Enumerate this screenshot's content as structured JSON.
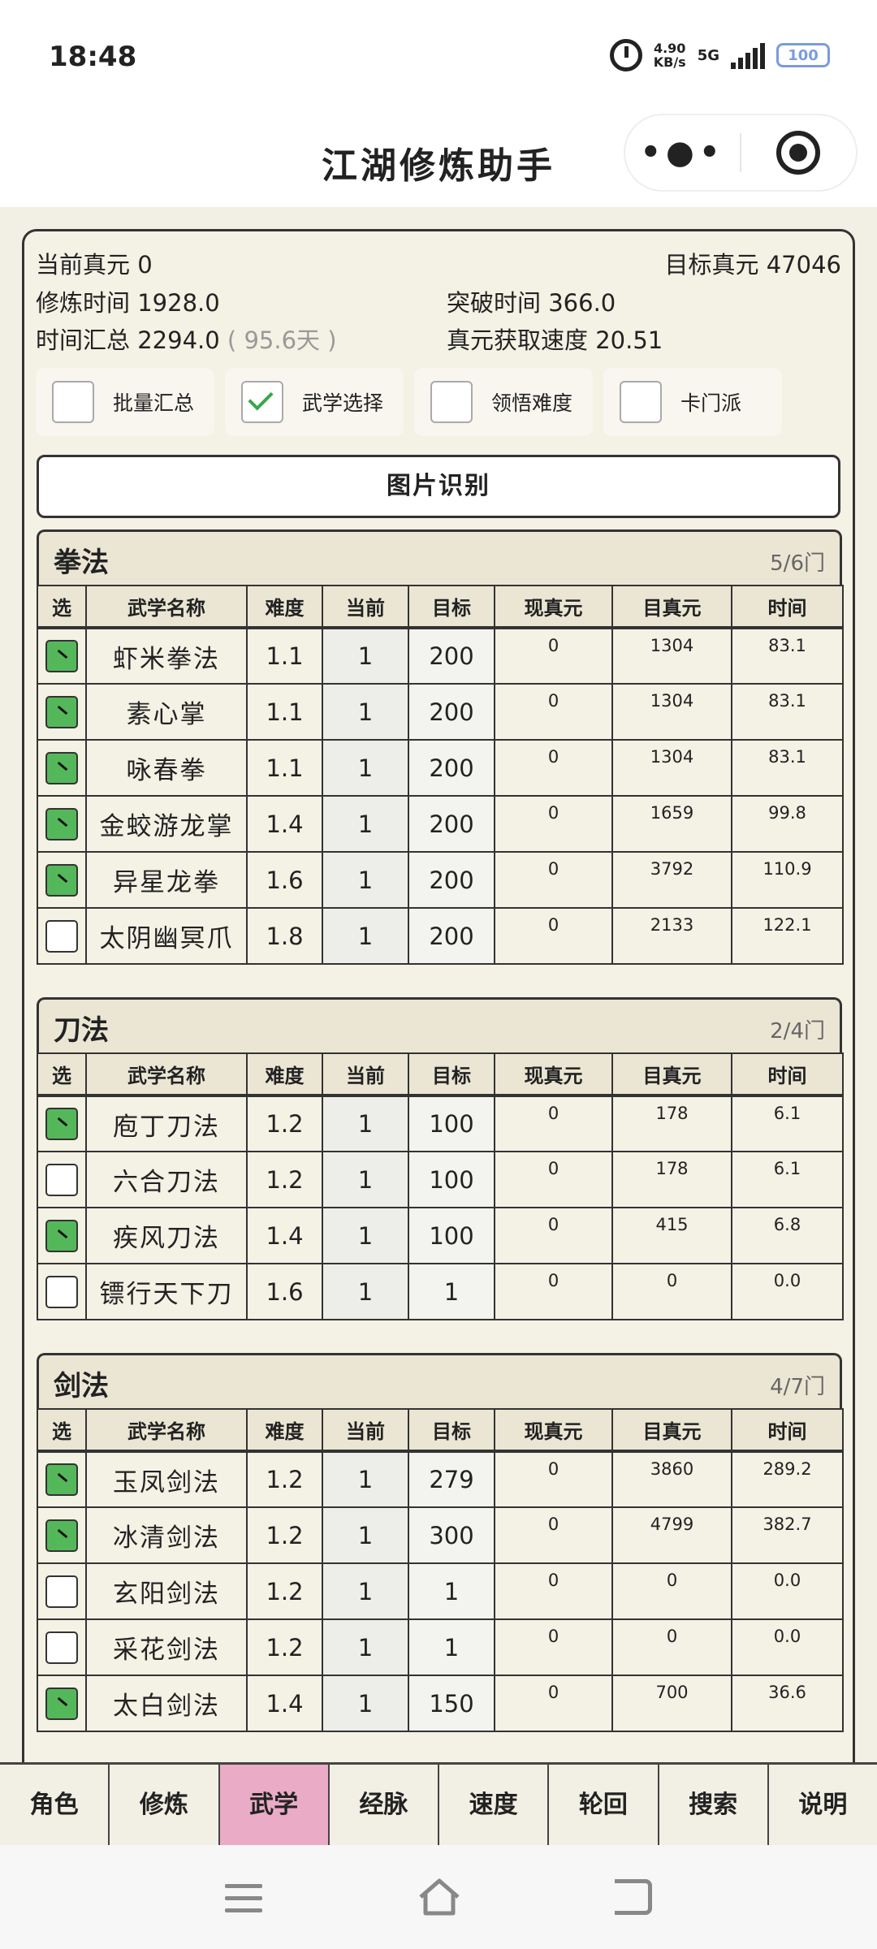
{
  "status": {
    "time": "18:48",
    "net_speed": "4.90",
    "net_unit": "KB/s",
    "signal": "5G",
    "battery": "100"
  },
  "app": {
    "title": "江湖修炼助手",
    "more_icon": "•●•"
  },
  "summary": {
    "current_energy": "当前真元 0",
    "target_energy": "目标真元 47046",
    "train_time": "修炼时间 1928.0",
    "break_time": "突破时间 366.0",
    "total_time": "时间汇总 2294.0",
    "total_days": "( 95.6天 )",
    "gain_speed": "真元获取速度 20.51"
  },
  "options": [
    {
      "label": "批量汇总",
      "checked": false
    },
    {
      "label": "武学选择",
      "checked": true
    },
    {
      "label": "领悟难度",
      "checked": false
    },
    {
      "label": "卡门派",
      "checked": false
    }
  ],
  "ocr_button": "图片识别",
  "columns": [
    "选",
    "武学名称",
    "难度",
    "当前",
    "目标",
    "现真元",
    "目真元",
    "时间"
  ],
  "sections": [
    {
      "title": "拳法",
      "count": "5/6门",
      "rows": [
        {
          "sel": true,
          "name": "虾米拳法",
          "diff": "1.1",
          "cur": "1",
          "tgt": "200",
          "now": "0",
          "need": "1304",
          "time": "83.1"
        },
        {
          "sel": true,
          "name": "素心掌",
          "diff": "1.1",
          "cur": "1",
          "tgt": "200",
          "now": "0",
          "need": "1304",
          "time": "83.1"
        },
        {
          "sel": true,
          "name": "咏春拳",
          "diff": "1.1",
          "cur": "1",
          "tgt": "200",
          "now": "0",
          "need": "1304",
          "time": "83.1"
        },
        {
          "sel": true,
          "name": "金蛟游龙掌",
          "diff": "1.4",
          "cur": "1",
          "tgt": "200",
          "now": "0",
          "need": "1659",
          "time": "99.8"
        },
        {
          "sel": true,
          "name": "异星龙拳",
          "diff": "1.6",
          "cur": "1",
          "tgt": "200",
          "now": "0",
          "need": "3792",
          "time": "110.9"
        },
        {
          "sel": false,
          "name": "太阴幽冥爪",
          "diff": "1.8",
          "cur": "1",
          "tgt": "200",
          "now": "0",
          "need": "2133",
          "time": "122.1"
        }
      ]
    },
    {
      "title": "刀法",
      "count": "2/4门",
      "rows": [
        {
          "sel": true,
          "name": "庖丁刀法",
          "diff": "1.2",
          "cur": "1",
          "tgt": "100",
          "now": "0",
          "need": "178",
          "time": "6.1"
        },
        {
          "sel": false,
          "name": "六合刀法",
          "diff": "1.2",
          "cur": "1",
          "tgt": "100",
          "now": "0",
          "need": "178",
          "time": "6.1"
        },
        {
          "sel": true,
          "name": "疾风刀法",
          "diff": "1.4",
          "cur": "1",
          "tgt": "100",
          "now": "0",
          "need": "415",
          "time": "6.8"
        },
        {
          "sel": false,
          "name": "镖行天下刀",
          "diff": "1.6",
          "cur": "1",
          "tgt": "1",
          "now": "0",
          "need": "0",
          "time": "0.0"
        }
      ]
    },
    {
      "title": "剑法",
      "count": "4/7门",
      "rows": [
        {
          "sel": true,
          "name": "玉凤剑法",
          "diff": "1.2",
          "cur": "1",
          "tgt": "279",
          "now": "0",
          "need": "3860",
          "time": "289.2"
        },
        {
          "sel": true,
          "name": "冰清剑法",
          "diff": "1.2",
          "cur": "1",
          "tgt": "300",
          "now": "0",
          "need": "4799",
          "time": "382.7"
        },
        {
          "sel": false,
          "name": "玄阳剑法",
          "diff": "1.2",
          "cur": "1",
          "tgt": "1",
          "now": "0",
          "need": "0",
          "time": "0.0"
        },
        {
          "sel": false,
          "name": "采花剑法",
          "diff": "1.2",
          "cur": "1",
          "tgt": "1",
          "now": "0",
          "need": "0",
          "time": "0.0"
        },
        {
          "sel": true,
          "name": "太白剑法",
          "diff": "1.4",
          "cur": "1",
          "tgt": "150",
          "now": "0",
          "need": "700",
          "time": "36.6"
        }
      ]
    }
  ],
  "tabs": [
    {
      "label": "角色",
      "active": false
    },
    {
      "label": "修炼",
      "active": false
    },
    {
      "label": "武学",
      "active": true
    },
    {
      "label": "经脉",
      "active": false
    },
    {
      "label": "速度",
      "active": false
    },
    {
      "label": "轮回",
      "active": false
    },
    {
      "label": "搜索",
      "active": false
    },
    {
      "label": "说明",
      "active": false
    }
  ]
}
